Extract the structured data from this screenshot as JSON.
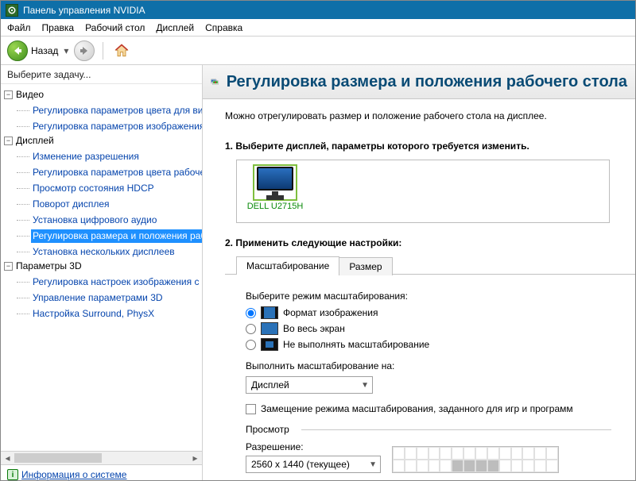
{
  "title": "Панель управления NVIDIA",
  "menu": {
    "file": "Файл",
    "edit": "Правка",
    "desktop": "Рабочий стол",
    "display": "Дисплей",
    "help": "Справка"
  },
  "toolbar": {
    "back": "Назад"
  },
  "sidebar": {
    "task_header": "Выберите задачу...",
    "groups": [
      {
        "label": "Видео",
        "items": [
          {
            "label": "Регулировка параметров цвета для вид"
          },
          {
            "label": "Регулировка параметров изображения д"
          }
        ]
      },
      {
        "label": "Дисплей",
        "items": [
          {
            "label": "Изменение разрешения"
          },
          {
            "label": "Регулировка параметров цвета рабочег"
          },
          {
            "label": "Просмотр состояния HDCP"
          },
          {
            "label": "Поворот дисплея"
          },
          {
            "label": "Установка цифрового аудио"
          },
          {
            "label": "Регулировка размера и положения рабоч",
            "selected": true
          },
          {
            "label": "Установка нескольких дисплеев"
          }
        ]
      },
      {
        "label": "Параметры 3D",
        "items": [
          {
            "label": "Регулировка настроек изображения с пр"
          },
          {
            "label": "Управление параметрами 3D"
          },
          {
            "label": "Настройка Surround, PhysX"
          }
        ]
      }
    ],
    "sysinfo": "Информация о системе"
  },
  "page": {
    "title": "Регулировка размера и положения рабочего стола",
    "intro": "Можно отрегулировать размер и положение рабочего стола на дисплее.",
    "step1": "1. Выберите дисплей, параметры которого требуется изменить.",
    "display_name": "DELL U2715H",
    "step2": "2. Применить следующие настройки:",
    "tabs": {
      "scaling": "Масштабирование",
      "size": "Размер"
    },
    "scaling": {
      "mode_label": "Выберите режим масштабирования:",
      "opt_aspect": "Формат изображения",
      "opt_full": "Во весь экран",
      "opt_none": "Не выполнять масштабирование",
      "perform_on_label": "Выполнить масштабирование на:",
      "perform_on_value": "Дисплей",
      "override": "Замещение режима масштабирования, заданного для игр и программ",
      "preview": "Просмотр",
      "resolution_label": "Разрешение:",
      "resolution_value": "2560 x 1440 (текущее)"
    }
  }
}
